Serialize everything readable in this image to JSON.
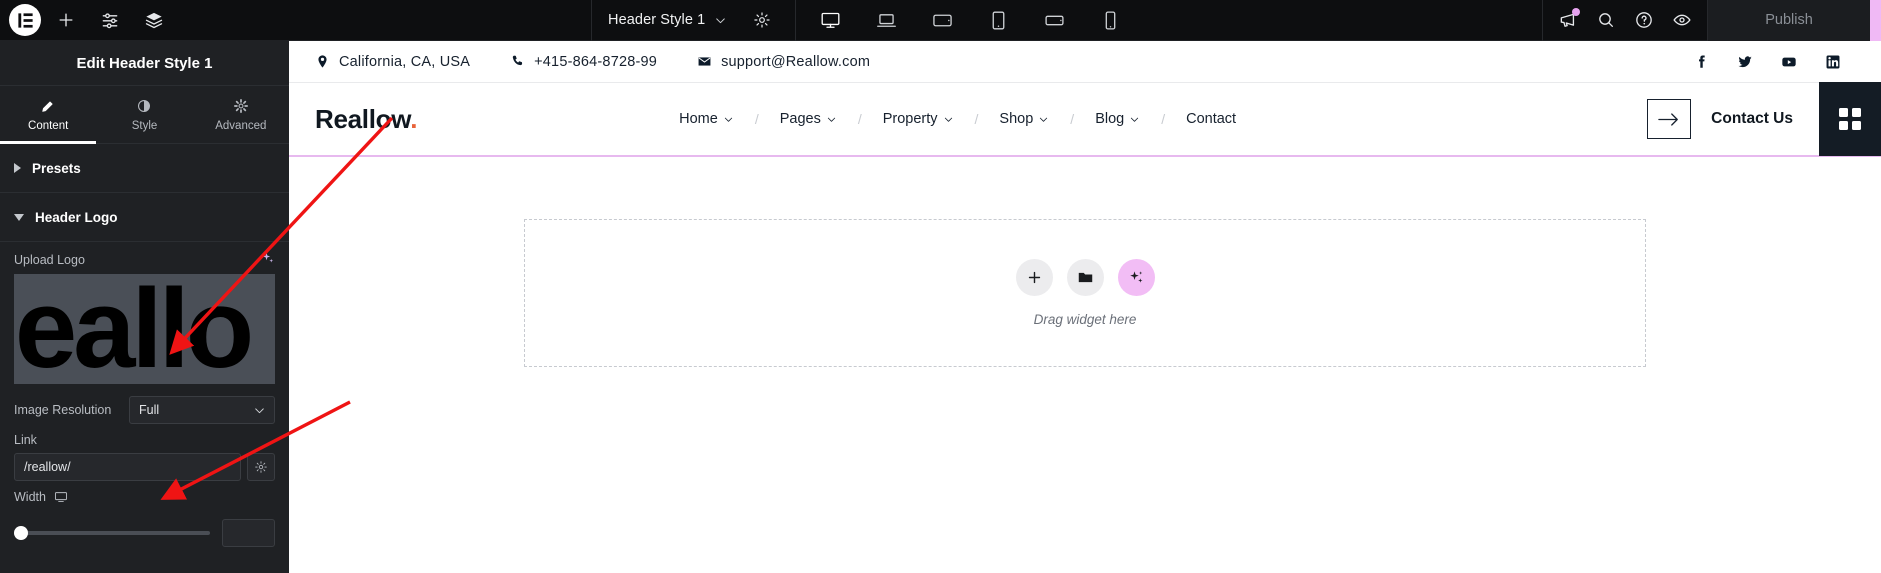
{
  "editor": {
    "logo_icon": "elementor-logo-icon",
    "add_icon": "plus-icon",
    "settings_icon": "sliders-icon",
    "layers_icon": "layers-icon",
    "document_name": "Header Style 1",
    "document_chevron_icon": "chevron-down-icon",
    "document_settings_icon": "gear-icon",
    "devices": [
      {
        "name": "desktop",
        "icon": "desktop-icon",
        "active": true
      },
      {
        "name": "laptop",
        "icon": "laptop-icon",
        "active": false
      },
      {
        "name": "tablet-landscape",
        "icon": "tablet-landscape-icon",
        "active": false
      },
      {
        "name": "tablet-portrait",
        "icon": "tablet-portrait-icon",
        "active": false
      },
      {
        "name": "mobile-landscape",
        "icon": "mobile-landscape-icon",
        "active": false
      },
      {
        "name": "mobile-portrait",
        "icon": "mobile-portrait-icon",
        "active": false
      }
    ],
    "right_icons": [
      {
        "name": "notifications",
        "icon": "megaphone-icon",
        "badge": true
      },
      {
        "name": "finder",
        "icon": "search-icon",
        "badge": false
      },
      {
        "name": "help",
        "icon": "question-circle-icon",
        "badge": false
      },
      {
        "name": "preview",
        "icon": "eye-icon",
        "badge": false
      }
    ],
    "publish_label": "Publish",
    "accent_color": "#f0b9f5"
  },
  "panel": {
    "title": "Edit Header Style 1",
    "tabs": [
      {
        "label": "Content",
        "icon": "pencil-icon",
        "active": true
      },
      {
        "label": "Style",
        "icon": "contrast-circle-icon",
        "active": false
      },
      {
        "label": "Advanced",
        "icon": "gear-icon",
        "active": false
      }
    ],
    "sections": [
      {
        "label": "Presets",
        "expanded": false
      },
      {
        "label": "Header Logo",
        "expanded": true
      }
    ],
    "upload_logo_label": "Upload Logo",
    "upload_logo_ai_icon": "ai-sparkle-icon",
    "logo_preview_text": "eallo",
    "image_resolution_label": "Image Resolution",
    "image_resolution_value": "Full",
    "image_resolution_options": [
      "Full"
    ],
    "link_label": "Link",
    "link_value": "/reallow/",
    "link_options_icon": "gear-icon",
    "width_label": "Width",
    "width_device_icon": "desktop-icon",
    "width_value": "",
    "collapse_icon": "chevron-left-icon"
  },
  "site": {
    "topbar": {
      "location_icon": "map-pin-icon",
      "location": "California, CA, USA",
      "phone_icon": "phone-icon",
      "phone": "+415-864-8728-99",
      "email_icon": "envelope-icon",
      "email": "support@Reallow.com",
      "social": [
        {
          "name": "facebook",
          "icon": "facebook-icon"
        },
        {
          "name": "twitter",
          "icon": "twitter-icon"
        },
        {
          "name": "youtube",
          "icon": "youtube-icon"
        },
        {
          "name": "linkedin",
          "icon": "linkedin-icon"
        }
      ]
    },
    "header": {
      "logo_text": "Reallow",
      "logo_dot": ".",
      "nav": [
        {
          "label": "Home",
          "has_dropdown": true
        },
        {
          "label": "Pages",
          "has_dropdown": true
        },
        {
          "label": "Property",
          "has_dropdown": true
        },
        {
          "label": "Shop",
          "has_dropdown": true
        },
        {
          "label": "Blog",
          "has_dropdown": true
        },
        {
          "label": "Contact",
          "has_dropdown": false
        }
      ],
      "nav_separator": "/",
      "arrow_icon": "arrow-right-icon",
      "cta_label": "Contact Us",
      "grid_icon": "grid-four-dots-icon",
      "underline_color": "#e7b9ef"
    },
    "dropzone": {
      "buttons": [
        {
          "name": "add-widget",
          "icon": "plus-icon"
        },
        {
          "name": "add-template",
          "icon": "folder-icon"
        },
        {
          "name": "ai-generate",
          "icon": "ai-sparkle-icon"
        }
      ],
      "label": "Drag widget here"
    }
  },
  "annotations": {
    "arrow_color": "#ef1414",
    "arrows": [
      {
        "name": "arrow-to-logo-preview"
      },
      {
        "name": "arrow-to-link-field"
      }
    ]
  }
}
